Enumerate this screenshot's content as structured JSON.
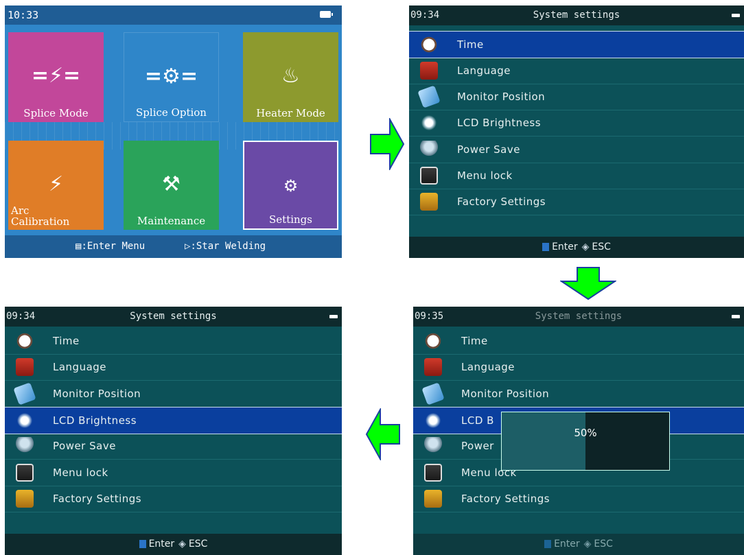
{
  "screen1": {
    "time": "10:33",
    "tiles": [
      {
        "label": "Splice Mode",
        "icon": "splice-icon",
        "glyph": "=⚡="
      },
      {
        "label": "Splice Option",
        "icon": "splice-option-icon",
        "glyph": "=⚙="
      },
      {
        "label": "Heater Mode",
        "icon": "heater-icon",
        "glyph": "♨"
      },
      {
        "label": "Arc\nCalibration",
        "icon": "arc-calibration-icon",
        "glyph": "⚡"
      },
      {
        "label": "Maintenance",
        "icon": "tools-icon",
        "glyph": "⚒"
      },
      {
        "label": "Settings",
        "icon": "gear-icon",
        "glyph": "⚙"
      }
    ],
    "footer": {
      "enter": ":Enter Menu",
      "start": ":Star Welding"
    }
  },
  "menu_items": [
    "Time",
    "Language",
    "Monitor Position",
    "LCD Brightness",
    "Power Save",
    "Menu lock",
    "Factory Settings"
  ],
  "screen2": {
    "time": "09:34",
    "title": "System settings",
    "selected_index": 0
  },
  "screen3": {
    "time": "09:34",
    "title": "System settings",
    "selected_index": 3
  },
  "screen4": {
    "time": "09:35",
    "title": "System settings",
    "selected_index": 3,
    "popup": {
      "value_text": "50%",
      "value": 0.5
    },
    "items_truncated": [
      "Time",
      "Language",
      "Monitor Position",
      "LCD B",
      "Power",
      "Menu lock",
      "Factory Settings"
    ]
  },
  "footer": {
    "enter": "Enter",
    "esc": "ESC"
  },
  "colors": {
    "arrow_fill": "#00ff00",
    "arrow_stroke": "#1a3fa0",
    "selected_row": "#0a3f9e",
    "screen_bg": "#0c5158"
  }
}
